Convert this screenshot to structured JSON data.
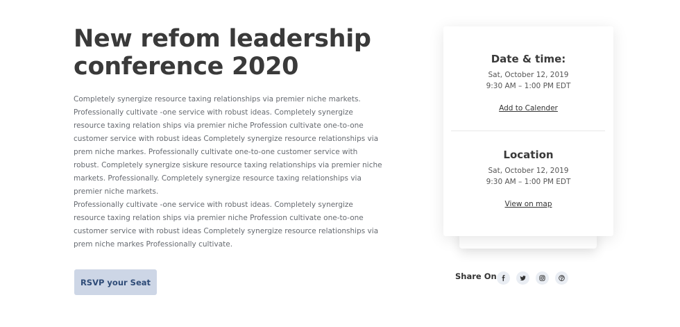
{
  "event": {
    "title": "New refom leadership conference 2020",
    "paragraph1": "Completely synergize resource taxing relationships via premier niche markets. Professionally cultivate -one service with robust ideas. Completely synergize resource taxing relation ships via premier niche Profession cultivate one-to-one customer service with robust ideas Completely synergize resource relationships via prem niche markes. Professionally cultivate one-to-one customer service with robust. Completely synergize siskure resource taxing relationships via premier niche markets. Professionally. Completely synergize resource taxing relationships via premier niche markets.",
    "paragraph2": "Professionally cultivate -one service with robust ideas. Completely synergize resource taxing relation ships via premier niche Profession cultivate one-to-one customer service with robust ideas Completely synergize resource relationships via prem niche markes Professionally cultivate.",
    "rsvp_label": "RSVP your Seat"
  },
  "card": {
    "date": {
      "heading": "Date & time:",
      "date_line": "Sat, October 12, 2019",
      "time_line": "9:30 AM – 1:00 PM EDT",
      "link": "Add to Calender"
    },
    "location": {
      "heading": "Location",
      "date_line": "Sat, October 12, 2019",
      "time_line": "9:30 AM – 1:00 PM EDT",
      "link": "View on map"
    }
  },
  "share": {
    "label": "Share On",
    "icons": [
      "facebook-icon",
      "twitter-icon",
      "instagram-icon",
      "pinterest-icon"
    ]
  },
  "colors": {
    "button_bg": "#cdd6e6",
    "button_text": "#2f4c78",
    "social_bg": "#e9edf3"
  }
}
